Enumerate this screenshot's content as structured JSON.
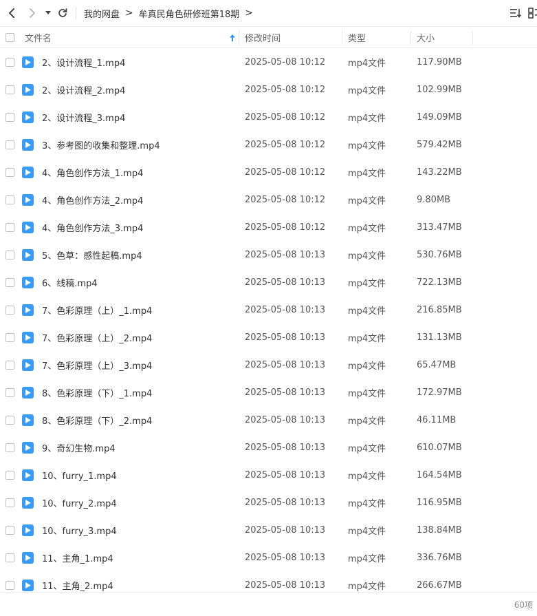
{
  "toolbar": {
    "breadcrumb": [
      "我的网盘",
      "牟真民角色研修班第18期"
    ]
  },
  "columns": {
    "name": "文件名",
    "modified": "修改时间",
    "type": "类型",
    "size": "大小"
  },
  "files": [
    {
      "name": "2、设计流程_1.mp4",
      "time": "2025-05-08 10:12",
      "type": "mp4文件",
      "size": "117.90MB"
    },
    {
      "name": "2、设计流程_2.mp4",
      "time": "2025-05-08 10:12",
      "type": "mp4文件",
      "size": "102.99MB"
    },
    {
      "name": "2、设计流程_3.mp4",
      "time": "2025-05-08 10:12",
      "type": "mp4文件",
      "size": "149.09MB"
    },
    {
      "name": "3、参考图的收集和整理.mp4",
      "time": "2025-05-08 10:12",
      "type": "mp4文件",
      "size": "579.42MB"
    },
    {
      "name": "4、角色创作方法_1.mp4",
      "time": "2025-05-08 10:12",
      "type": "mp4文件",
      "size": "143.22MB"
    },
    {
      "name": "4、角色创作方法_2.mp4",
      "time": "2025-05-08 10:12",
      "type": "mp4文件",
      "size": "9.80MB"
    },
    {
      "name": "4、角色创作方法_3.mp4",
      "time": "2025-05-08 10:12",
      "type": "mp4文件",
      "size": "313.47MB"
    },
    {
      "name": "5、色草：感性起稿.mp4",
      "time": "2025-05-08 10:13",
      "type": "mp4文件",
      "size": "530.76MB"
    },
    {
      "name": "6、线稿.mp4",
      "time": "2025-05-08 10:13",
      "type": "mp4文件",
      "size": "722.13MB"
    },
    {
      "name": "7、色彩原理（上）_1.mp4",
      "time": "2025-05-08 10:13",
      "type": "mp4文件",
      "size": "216.85MB"
    },
    {
      "name": "7、色彩原理（上）_2.mp4",
      "time": "2025-05-08 10:13",
      "type": "mp4文件",
      "size": "131.13MB"
    },
    {
      "name": "7、色彩原理（上）_3.mp4",
      "time": "2025-05-08 10:13",
      "type": "mp4文件",
      "size": "65.47MB"
    },
    {
      "name": "8、色彩原理（下）_1.mp4",
      "time": "2025-05-08 10:13",
      "type": "mp4文件",
      "size": "172.97MB"
    },
    {
      "name": "8、色彩原理（下）_2.mp4",
      "time": "2025-05-08 10:13",
      "type": "mp4文件",
      "size": "46.11MB"
    },
    {
      "name": "9、奇幻生物.mp4",
      "time": "2025-05-08 10:13",
      "type": "mp4文件",
      "size": "610.07MB"
    },
    {
      "name": "10、furry_1.mp4",
      "time": "2025-05-08 10:13",
      "type": "mp4文件",
      "size": "164.54MB"
    },
    {
      "name": "10、furry_2.mp4",
      "time": "2025-05-08 10:13",
      "type": "mp4文件",
      "size": "116.95MB"
    },
    {
      "name": "10、furry_3.mp4",
      "time": "2025-05-08 10:13",
      "type": "mp4文件",
      "size": "138.84MB"
    },
    {
      "name": "11、主角_1.mp4",
      "time": "2025-05-08 10:13",
      "type": "mp4文件",
      "size": "336.76MB"
    },
    {
      "name": "11、主角_2.mp4",
      "time": "2025-05-08 10:13",
      "type": "mp4文件",
      "size": "266.67MB"
    }
  ],
  "footer": {
    "count": "60项"
  },
  "icons": {
    "back": "chevron-left-icon",
    "forward": "chevron-right-icon",
    "history": "caret-down-icon",
    "refresh": "refresh-icon",
    "sort": "sort-list-icon",
    "view": "grid-view-icon",
    "sort_indicator": "arrow-up-icon",
    "file": "video-file-icon"
  },
  "colors": {
    "accent": "#3a9bf0",
    "sort_arrow": "#2f8ef5"
  }
}
